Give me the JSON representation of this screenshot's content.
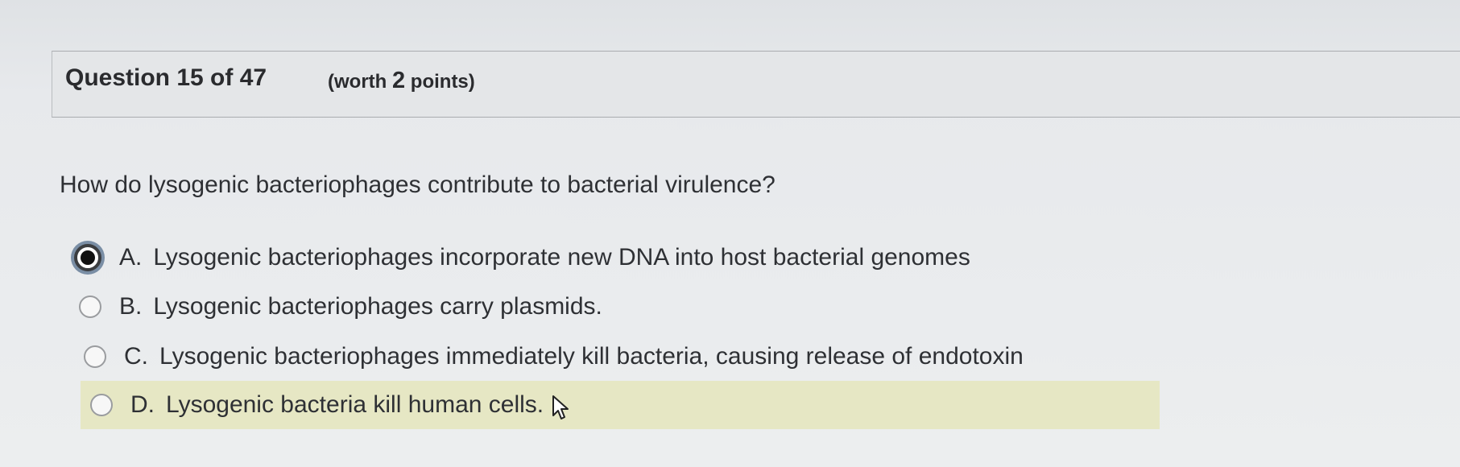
{
  "header": {
    "question_label": "Question 15 of 47",
    "points_prefix": "(worth ",
    "points_value": "2",
    "points_suffix": " points)"
  },
  "question": {
    "prompt": "How do lysogenic bacteriophages contribute to bacterial virulence?"
  },
  "options": [
    {
      "letter": "A.",
      "text": "Lysogenic bacteriophages incorporate new DNA into host bacterial genomes",
      "selected": true
    },
    {
      "letter": "B.",
      "text": "Lysogenic bacteriophages carry plasmids.",
      "selected": false
    },
    {
      "letter": "C.",
      "text": "Lysogenic bacteriophages immediately kill bacteria, causing release of endotoxin",
      "selected": false
    },
    {
      "letter": "D.",
      "text": "Lysogenic bacteria kill human cells.",
      "selected": false,
      "hovered": true
    }
  ],
  "colors": {
    "hover_highlight": "#e6e7c4",
    "selected_ring": "#7a8ea5"
  },
  "icons": {
    "cursor": "arrow-pointer-icon"
  }
}
